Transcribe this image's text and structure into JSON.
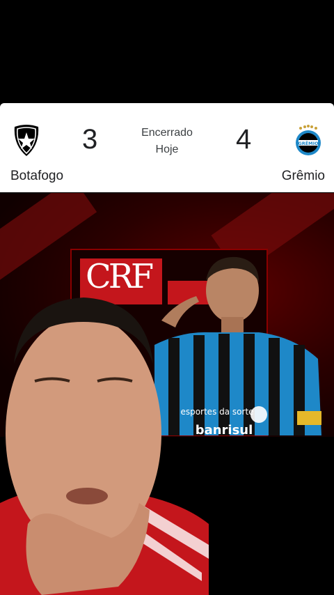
{
  "match": {
    "home_team": "Botafogo",
    "away_team": "Grêmio",
    "home_score": "3",
    "away_score": "4",
    "status": "Encerrado",
    "date": "Hoje"
  },
  "colors": {
    "card_bg": "#ffffff",
    "text": "#202124",
    "gremio_blue": "#1e88c8",
    "flamengo_red": "#c4161c"
  },
  "icons": {
    "home_crest": "botafogo-star-crest",
    "away_crest": "gremio-crest"
  },
  "video": {
    "jersey_sponsor": "banrisul",
    "jersey_text": "esportes da sorte",
    "crest_label": "GRÊMIO"
  }
}
